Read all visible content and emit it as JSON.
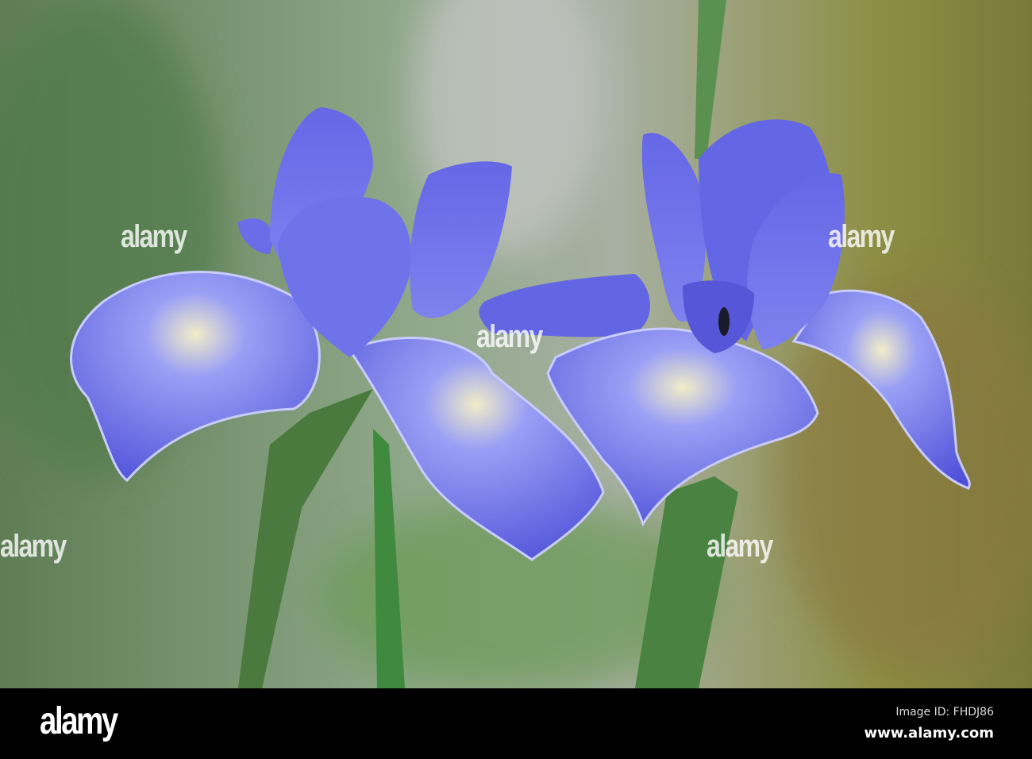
{
  "photo": {
    "subject": "Two blue iris flowers",
    "colors": {
      "petal": "#5b5ee0",
      "petal_light": "#8a90f0",
      "bg_green": "#6f8f5a",
      "bg_olive": "#8a8a3a",
      "stem": "#4f8a45"
    }
  },
  "watermarks": [
    "alamy",
    "alamy",
    "alamy",
    "alamy",
    "alamy"
  ],
  "footer": {
    "logo": "alamy",
    "image_id": "Image ID: FHDJ86",
    "site": "www.alamy.com"
  }
}
